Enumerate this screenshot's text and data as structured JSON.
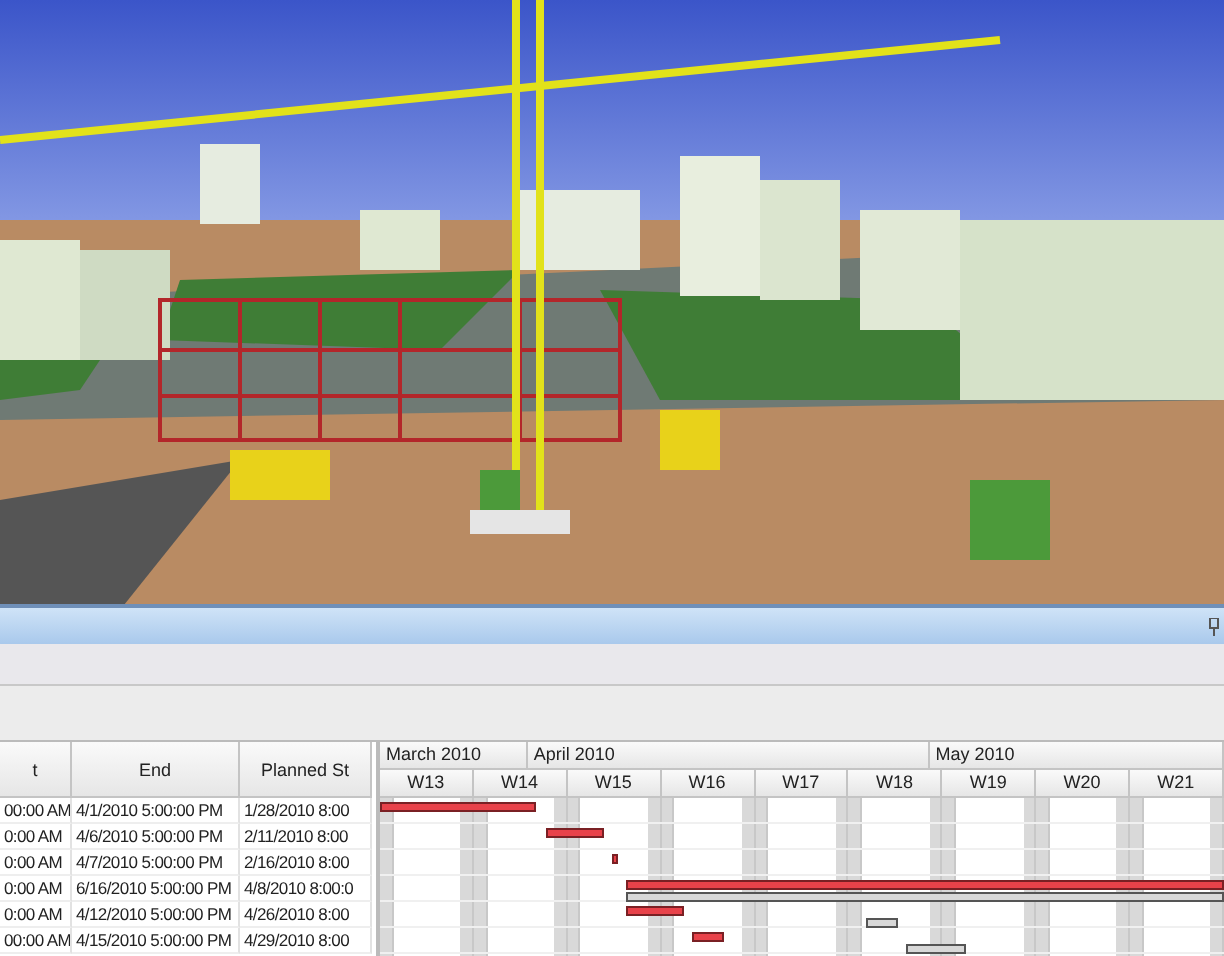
{
  "table": {
    "columns": [
      "t",
      "End",
      "Planned St"
    ],
    "rows": [
      {
        "cells": [
          "00:00 AM",
          "4/1/2010 5:00:00 PM",
          "1/28/2010 8:00"
        ]
      },
      {
        "cells": [
          "0:00 AM",
          "4/6/2010 5:00:00 PM",
          "2/11/2010 8:00"
        ]
      },
      {
        "cells": [
          "0:00 AM",
          "4/7/2010 5:00:00 PM",
          "2/16/2010 8:00"
        ]
      },
      {
        "cells": [
          "0:00 AM",
          "6/16/2010 5:00:00 PM",
          "4/8/2010 8:00:0"
        ]
      },
      {
        "cells": [
          "0:00 AM",
          "4/12/2010 5:00:00 PM",
          "4/26/2010 8:00"
        ]
      },
      {
        "cells": [
          "00:00 AM",
          "4/15/2010 5:00:00 PM",
          "4/29/2010 8:00"
        ]
      }
    ]
  },
  "gantt": {
    "months": [
      "March 2010",
      "April 2010",
      "May 2010"
    ],
    "weeks": [
      "W13",
      "W14",
      "W15",
      "W16",
      "W17",
      "W18",
      "W19",
      "W20",
      "W21"
    ]
  }
}
